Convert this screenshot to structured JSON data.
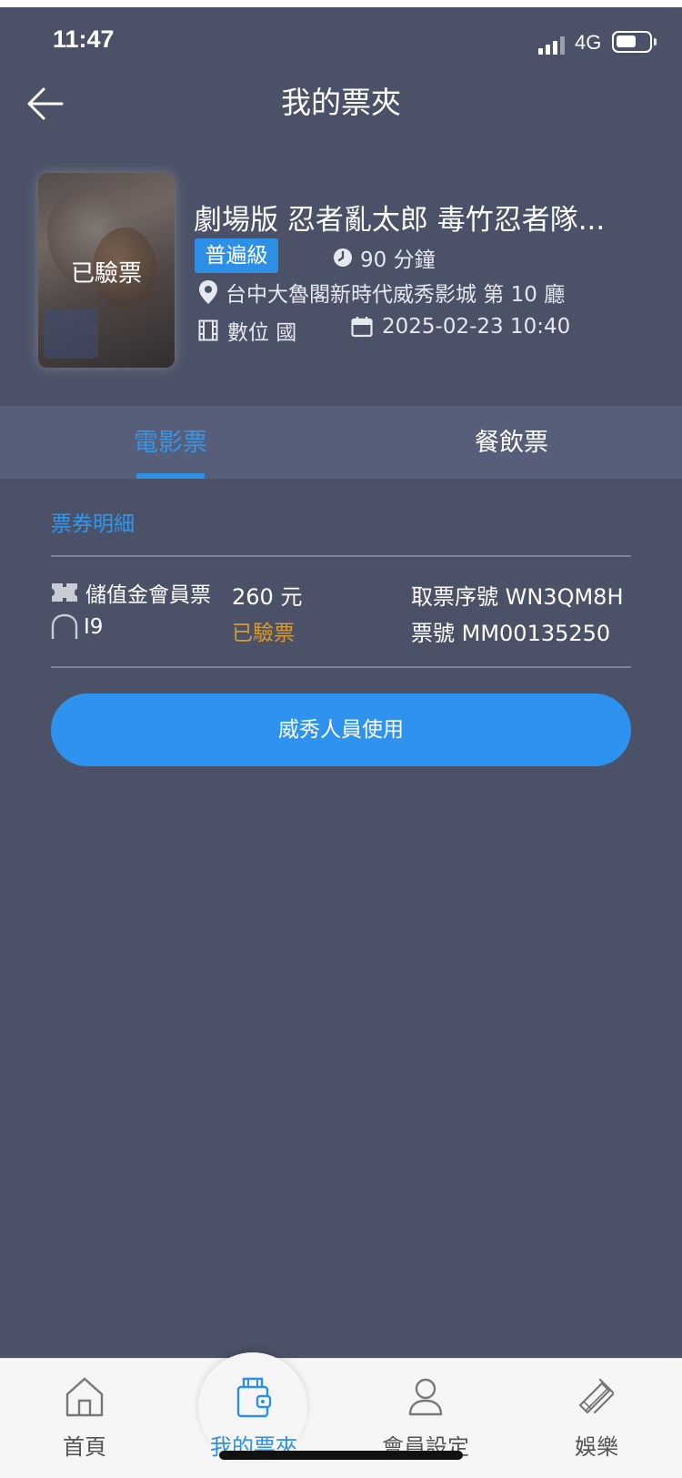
{
  "status_bar": {
    "time": "11:47",
    "network": "4G"
  },
  "header": {
    "title": "我的票夾"
  },
  "movie": {
    "poster_stamp": "已驗票",
    "title": "劇場版 忍者亂太郎 毒竹忍者隊...",
    "rating": "普遍級",
    "duration": "90 分鐘",
    "location": "台中大魯閣新時代威秀影城 第 10 廳",
    "format": "數位 國",
    "showtime": "2025-02-23 10:40"
  },
  "tabs": [
    {
      "label": "電影票",
      "active": true
    },
    {
      "label": "餐飲票",
      "active": false
    }
  ],
  "ticket": {
    "section_label": "票券明細",
    "type": "儲值金會員票",
    "seat": "I9",
    "price": "260 元",
    "status": "已驗票",
    "pickup_code": "取票序號 WN3QM8H",
    "ticket_no": "票號 MM00135250"
  },
  "staff_button": "威秀人員使用",
  "bottom_nav": [
    {
      "label": "首頁",
      "icon": "home-icon"
    },
    {
      "label": "我的票夾",
      "icon": "wallet-icon",
      "active": true
    },
    {
      "label": "會員設定",
      "icon": "user-icon"
    },
    {
      "label": "娛樂",
      "icon": "entertainment-icon"
    }
  ],
  "colors": {
    "background": "#4b5166",
    "accent": "#2e8fe6",
    "status_warn": "#d99a2e"
  }
}
